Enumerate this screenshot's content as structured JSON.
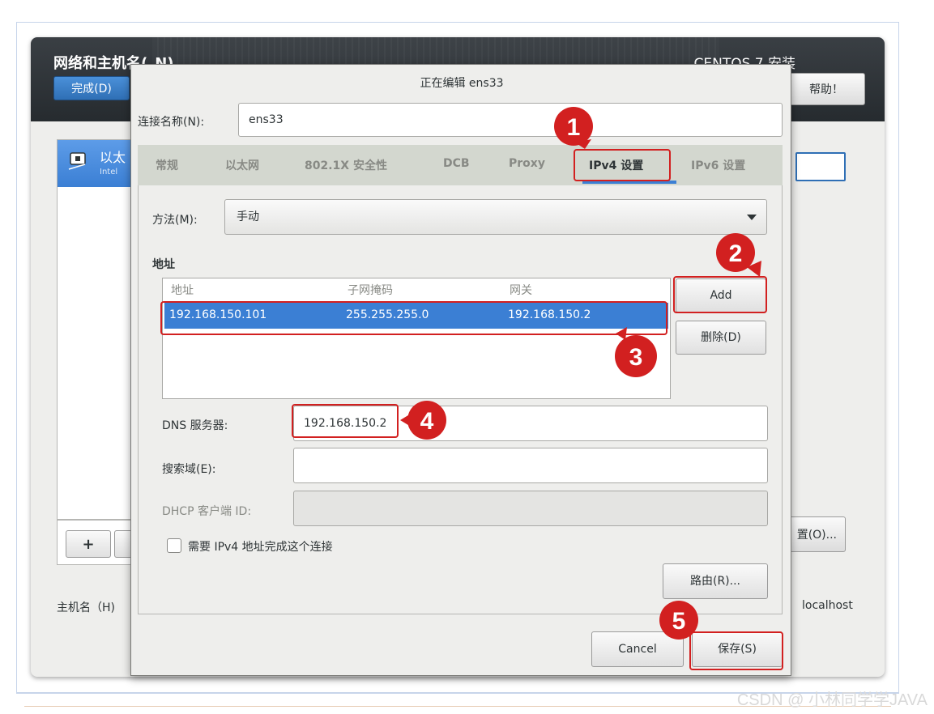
{
  "colors": {
    "accent": "#3b7fd4",
    "annotation_red": "#d22020",
    "header_dark": "#2b3035"
  },
  "installer": {
    "title": "网络和主机名(_N)",
    "distro": "CENTOS 7 安装",
    "done_label": "完成(D)",
    "help_label": "帮助！",
    "net_item_title": "以太",
    "net_item_sub": "Intel",
    "add_label": "+",
    "remove_label": "-",
    "config_label": "置(O)...",
    "hostname_label": "主机名（H)",
    "hostname_value": "localhost"
  },
  "dialog": {
    "title": "正在编辑 ens33",
    "conn_name_label": "连接名称(N):",
    "conn_name_value": "ens33",
    "tabs": [
      "常规",
      "以太网",
      "802.1X 安全性",
      "DCB",
      "Proxy",
      "IPv4 设置",
      "IPv6 设置"
    ],
    "active_tab": "IPv4 设置",
    "method_label": "方法(M):",
    "method_value": "手动",
    "address_heading": "地址",
    "columns": [
      "地址",
      "子网掩码",
      "网关"
    ],
    "rows": [
      [
        "192.168.150.101",
        "255.255.255.0",
        "192.168.150.2"
      ]
    ],
    "add_label": "Add",
    "delete_label": "删除(D)",
    "dns_label": "DNS 服务器:",
    "dns_value": "192.168.150.2",
    "search_label": "搜索域(E):",
    "search_value": "",
    "dhcp_label": "DHCP 客户端 ID:",
    "dhcp_value": "",
    "require_ipv4_label": "需要 IPv4 地址完成这个连接",
    "require_ipv4_checked": false,
    "routes_label": "路由(R)...",
    "cancel_label": "Cancel",
    "save_label": "保存(S)"
  },
  "annotations": [
    "1",
    "2",
    "3",
    "4",
    "5"
  ],
  "watermark": "CSDN @ 小林同学学JAVA"
}
